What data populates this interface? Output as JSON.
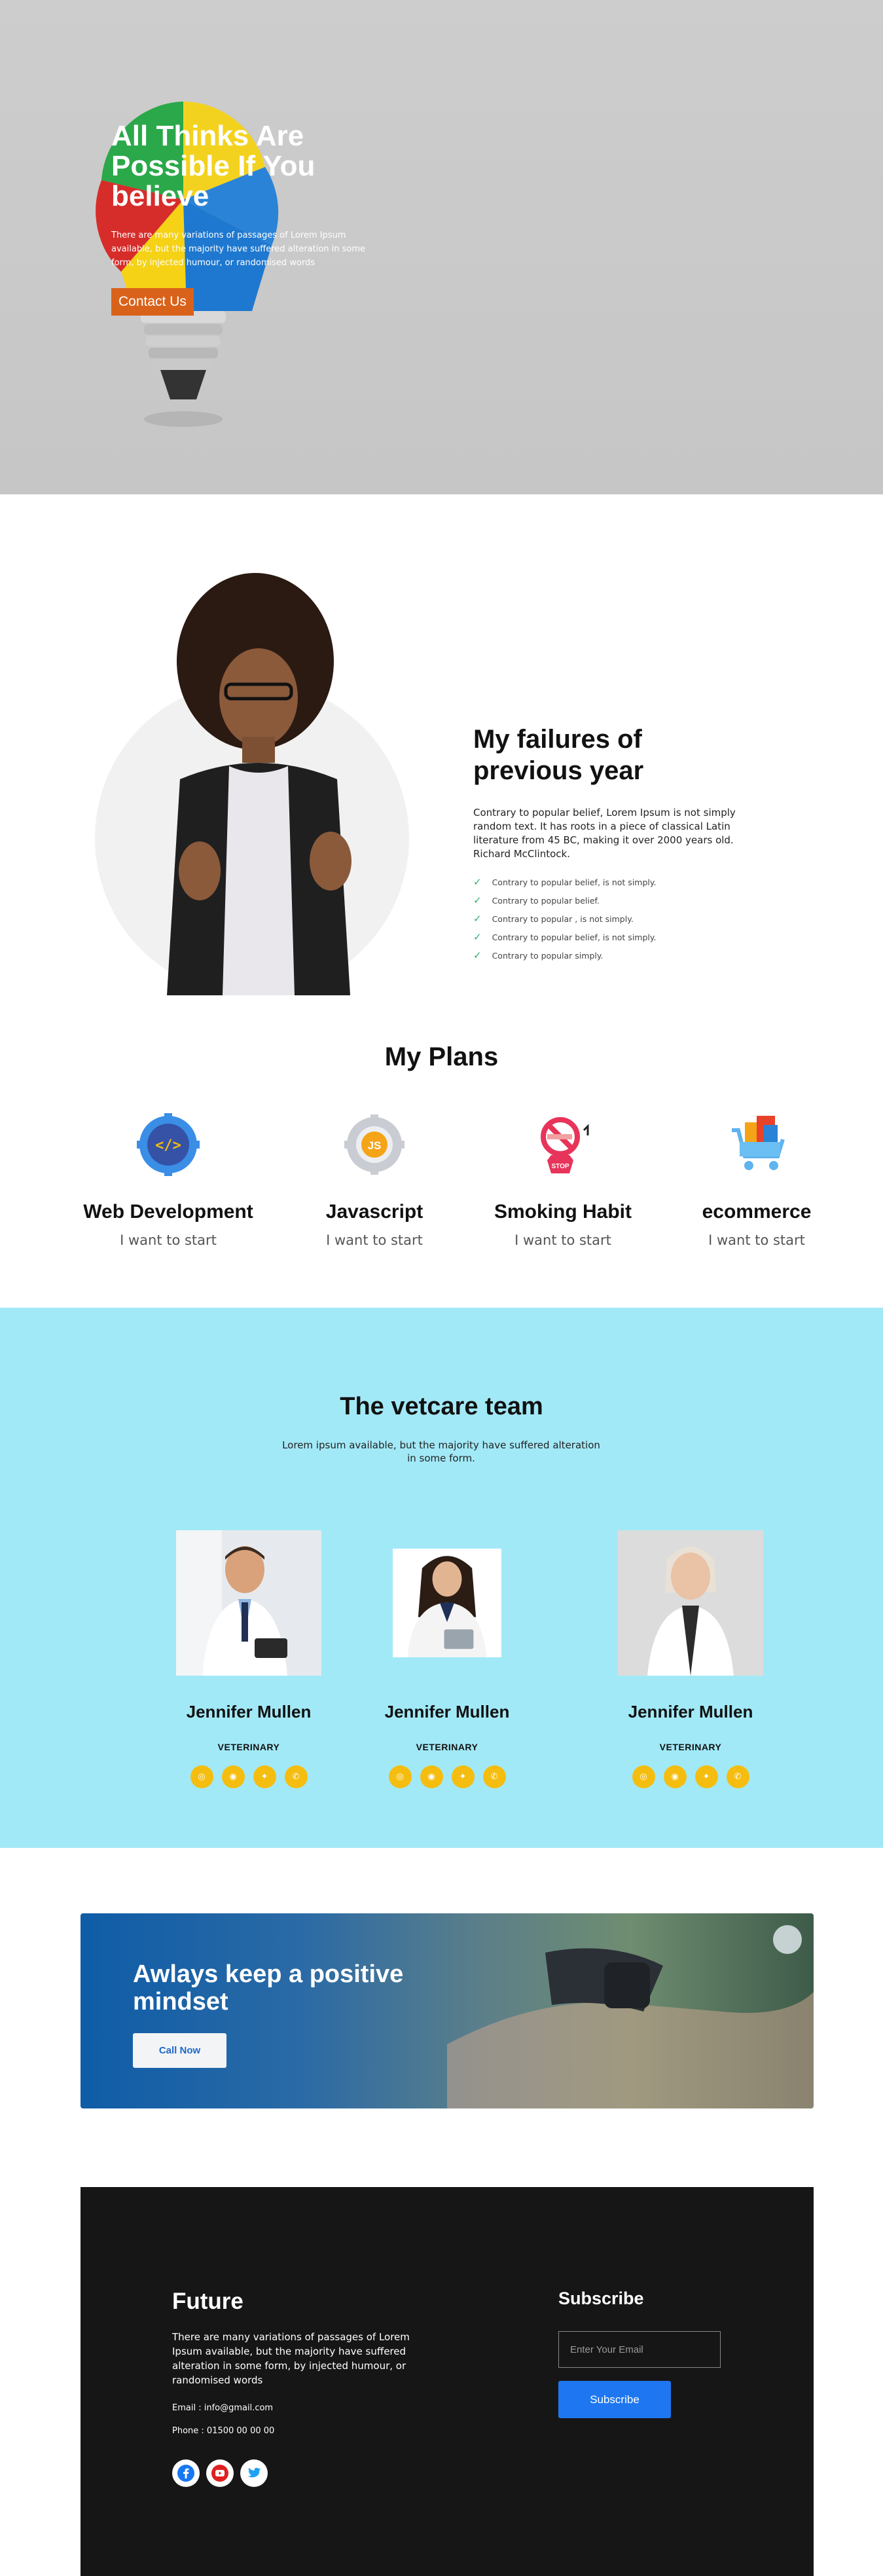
{
  "hero": {
    "title": "All Thinks Are Possible If You believe",
    "text": "There are many variations of passages of Lorem Ipsum available, but the majority have suffered alteration in some form, by injected humour, or randomised words",
    "button": "Contact Us"
  },
  "failures": {
    "title": "My failures of previous year",
    "text": "Contrary to popular belief, Lorem Ipsum is not simply random text. It has roots in a piece of classical Latin literature from 45 BC, making it over 2000 years old. Richard McClintock.",
    "items": [
      "Contrary to popular belief, is not simply.",
      "Contrary to popular belief.",
      "Contrary to popular , is not simply.",
      "Contrary to popular belief, is not simply.",
      "Contrary to popular simply."
    ]
  },
  "plans": {
    "title": "My Plans",
    "items": [
      {
        "title": "Web Development",
        "subtitle": "I want to start",
        "icon": "code-gear-icon"
      },
      {
        "title": "Javascript",
        "subtitle": "I want to start",
        "icon": "js-gear-icon",
        "badge": "JS"
      },
      {
        "title": "Smoking Habit",
        "subtitle": "I want to start",
        "icon": "stop-smoking-icon",
        "badge": "STOP"
      },
      {
        "title": "ecommerce",
        "subtitle": "I want to start",
        "icon": "shopping-cart-icon"
      }
    ]
  },
  "team": {
    "title": "The vetcare team",
    "subtitle": "Lorem ipsum available, but the majority have suffered alteration in some form.",
    "members": [
      {
        "name": "Jennifer Mullen",
        "role": "VETERINARY"
      },
      {
        "name": "Jennifer Mullen",
        "role": "VETERINARY"
      },
      {
        "name": "Jennifer Mullen",
        "role": "VETERINARY"
      }
    ]
  },
  "cta": {
    "title": "Awlays keep a positive mindset",
    "button": "Call Now"
  },
  "footer": {
    "brand": "Future",
    "text": "There are many variations of passages of Lorem Ipsum available, but the majority have suffered alteration in some form, by injected humour, or randomised words",
    "email": "Email : info@gmail.com",
    "phone": "Phone : 01500 00 00 00",
    "subscribe_title": "Subscribe",
    "input_placeholder": "Enter Your Email",
    "subscribe_button": "Subscribe"
  },
  "colors": {
    "hero_button": "#d9621b",
    "team_bg": "#a2e9f7",
    "social_yellow": "#f5bd0f",
    "check_green": "#27b36c",
    "footer_bg": "#161616",
    "subscribe_blue": "#1e77f0"
  }
}
